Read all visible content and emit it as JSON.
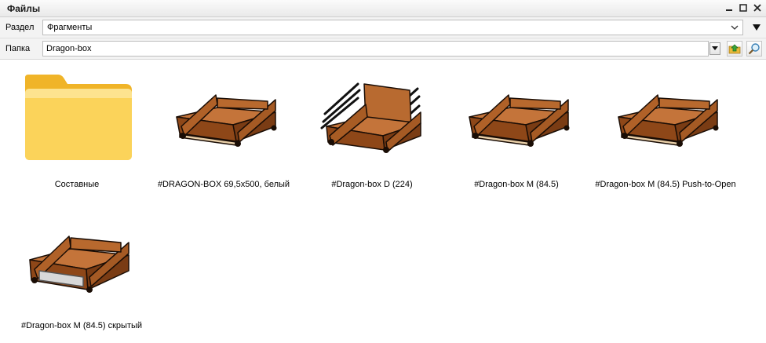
{
  "window": {
    "title": "Файлы"
  },
  "section": {
    "label": "Раздел",
    "value": "Фрагменты"
  },
  "folder": {
    "label": "Папка",
    "value": "Dragon-box"
  },
  "items": [
    {
      "name": "Составные",
      "icon": "folder-icon"
    },
    {
      "name": "#DRAGON-BOX 69,5x500, белый",
      "icon": "drawer-icon"
    },
    {
      "name": "#Dragon-box D (224)",
      "icon": "drawer-tall-icon"
    },
    {
      "name": "#Dragon-box M (84.5)",
      "icon": "drawer-icon"
    },
    {
      "name": "#Dragon-box M (84.5) Push-to-Open",
      "icon": "drawer-icon"
    },
    {
      "name": "#Dragon-box M (84.5) скрытый",
      "icon": "drawer-hidden-icon"
    }
  ],
  "colors": {
    "wood": "#9a4e1c",
    "wood_light": "#c7753a",
    "folder": "#f8c84a"
  }
}
